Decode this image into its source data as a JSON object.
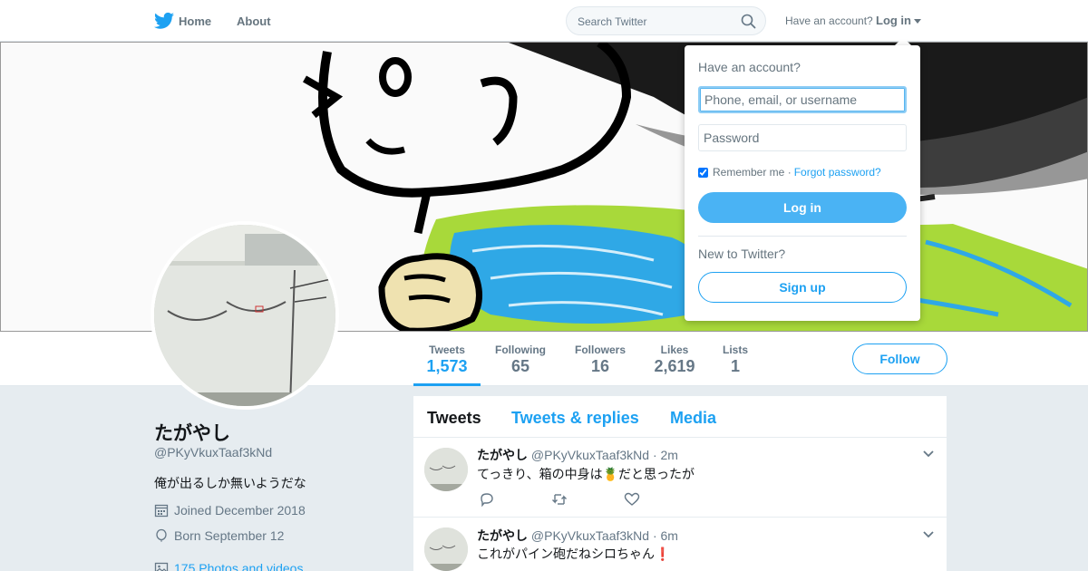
{
  "nav": {
    "home_label": "Home",
    "about_label": "About",
    "search_placeholder": "Search Twitter",
    "have_account": "Have an account?",
    "login_label": "Log in"
  },
  "profile": {
    "name": "たがやし",
    "handle": "@PKyVkuxTaaf3kNd",
    "bio": "俺が出るしか無いようだな",
    "joined": "Joined December 2018",
    "born": "Born September 12",
    "photos": "175 Photos and videos"
  },
  "stats": [
    {
      "label": "Tweets",
      "value": "1,573",
      "active": true
    },
    {
      "label": "Following",
      "value": "65",
      "active": false
    },
    {
      "label": "Followers",
      "value": "16",
      "active": false
    },
    {
      "label": "Likes",
      "value": "2,619",
      "active": false
    },
    {
      "label": "Lists",
      "value": "1",
      "active": false
    }
  ],
  "follow_label": "Follow",
  "timeline": {
    "tabs": [
      "Tweets",
      "Tweets & replies",
      "Media"
    ],
    "tweets": [
      {
        "name": "たがやし",
        "handle": "@PKyVkuxTaaf3kNd",
        "time": "· 2m",
        "text": "てっきり、箱の中身は🍍だと思ったが"
      },
      {
        "name": "たがやし",
        "handle": "@PKyVkuxTaaf3kNd",
        "time": "· 6m",
        "text": "これがパイン砲だねシロちゃん❗"
      }
    ]
  },
  "login_dropdown": {
    "title": "Have an account?",
    "username_placeholder": "Phone, email, or username",
    "password_placeholder": "Password",
    "remember_me": "Remember me ·",
    "remember_checked": true,
    "forgot_password": "Forgot password?",
    "login_button": "Log in",
    "new_to_twitter": "New to Twitter?",
    "signup_button": "Sign up"
  },
  "colors": {
    "brand": "#1da1f2",
    "login_button": "#4ab3f4",
    "background": "#e6ecf0"
  }
}
